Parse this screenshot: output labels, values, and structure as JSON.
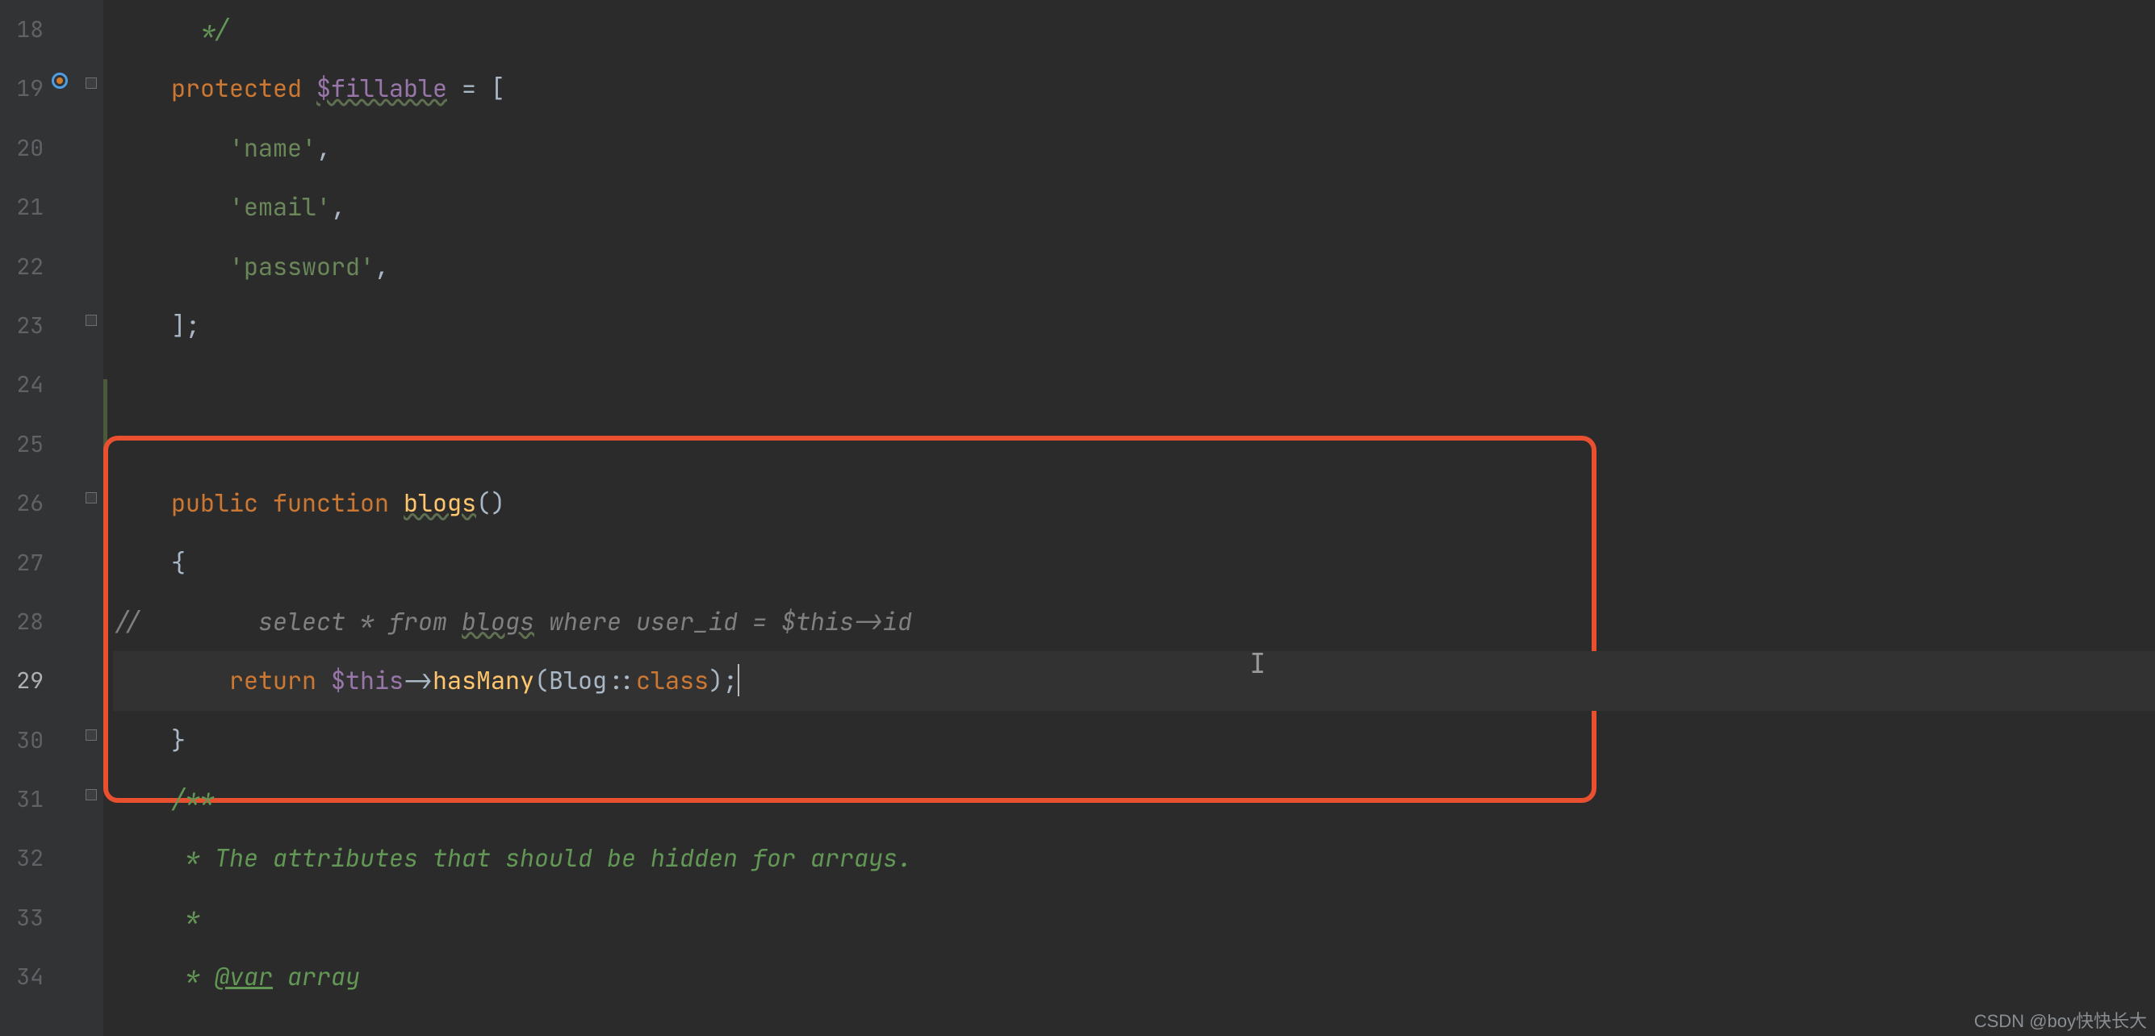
{
  "gutter": {
    "start": 18,
    "end": 34,
    "current": 29
  },
  "code": {
    "l18": {
      "doc_close": " */"
    },
    "l19": {
      "kw_prot": "protected",
      "var": "$fillable",
      "rest": " = ["
    },
    "l20": {
      "str": "'name'",
      "comma": ","
    },
    "l21": {
      "str": "'email'",
      "comma": ","
    },
    "l22": {
      "str": "'password'",
      "comma": ","
    },
    "l23": {
      "close": "];"
    },
    "l26": {
      "kw_pub": "public",
      "kw_fn": "function",
      "fn": "blogs",
      "paren": "()"
    },
    "l27": {
      "brace": "{"
    },
    "l28": {
      "slashes": "//",
      "select": "select * from ",
      "blogs": "blogs",
      "rest": " where user_id = $this->id"
    },
    "l29": {
      "kw_return": "return",
      "sp": " ",
      "this": "$this",
      "arrow": "->",
      "call": "hasMany",
      "open": "(",
      "cls": "Blog",
      "scope": "::",
      "kw_class": "class",
      "close": ");"
    },
    "l30": {
      "brace": "}"
    },
    "l31": {
      "doc_open": "/**"
    },
    "l32": {
      "doc": " * The attributes that should be hidden for arrays."
    },
    "l33": {
      "doc": " *"
    },
    "l34": {
      "doc_pre": " * ",
      "tag": "@var",
      "doc_post": " array"
    }
  },
  "watermark": "CSDN @boy快快长大"
}
